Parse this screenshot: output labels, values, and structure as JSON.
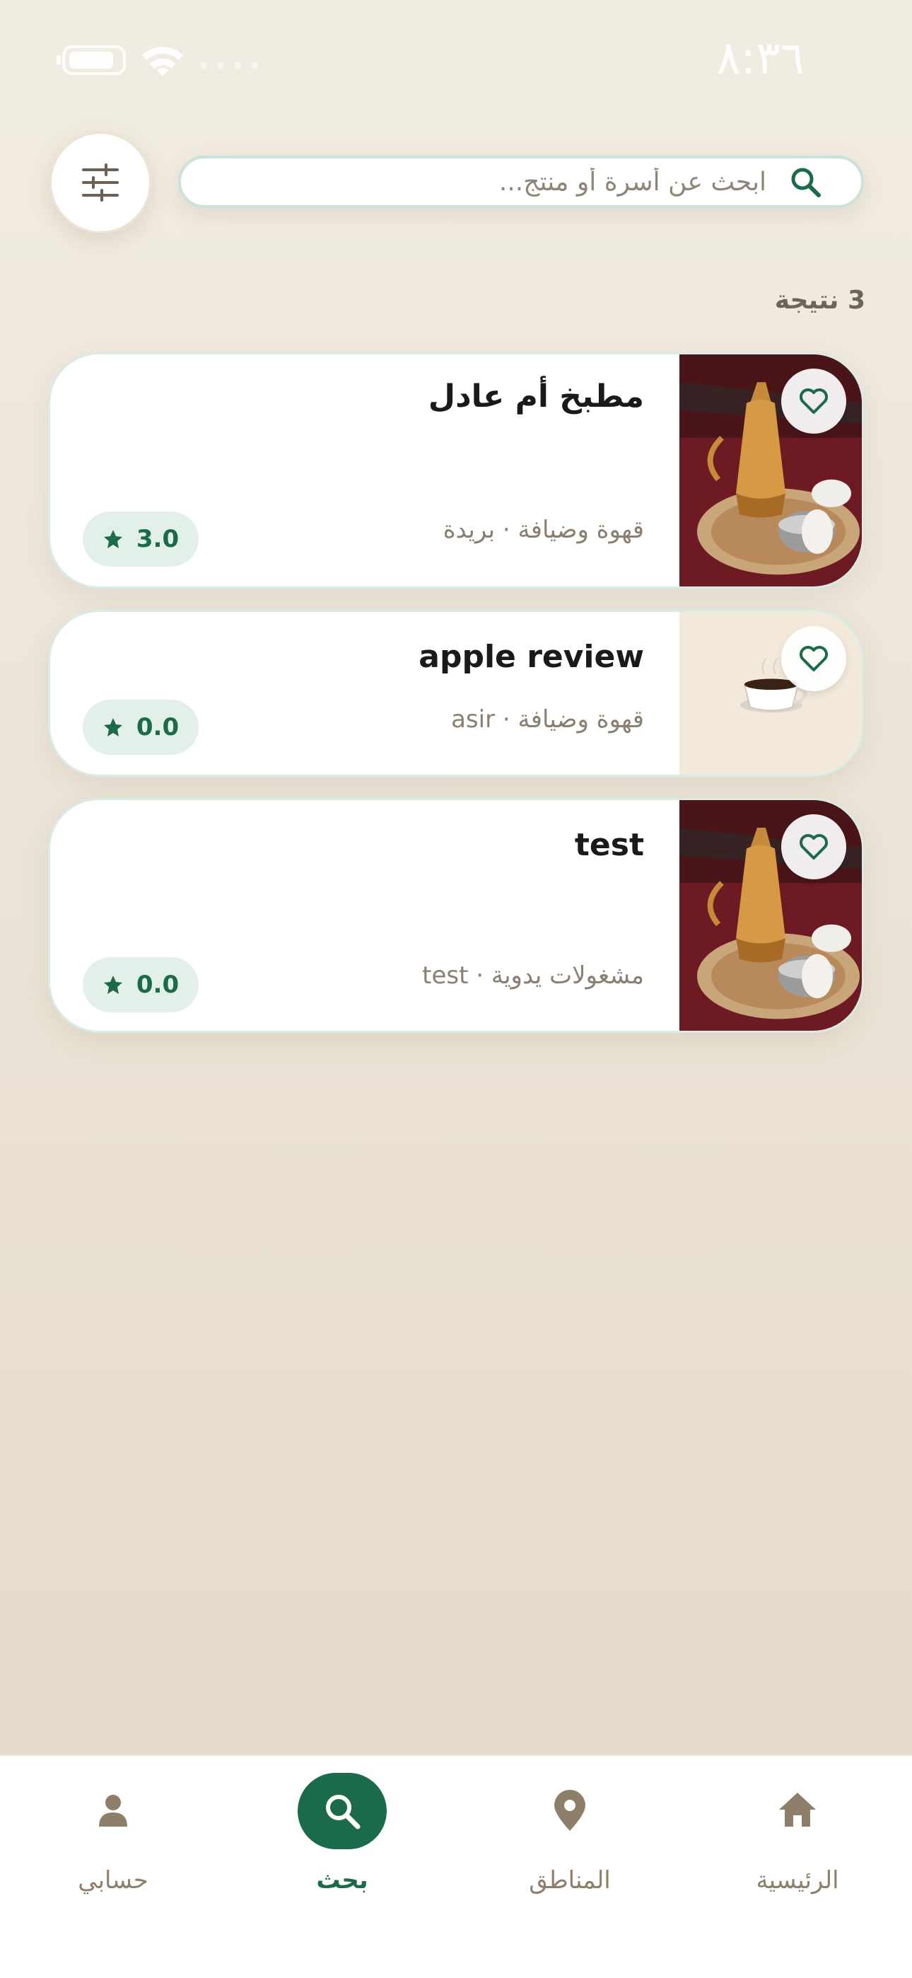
{
  "status_bar": {
    "time": "٨:٣٦"
  },
  "search": {
    "placeholder": "ابحث عن أسرة أو منتج..."
  },
  "results": {
    "count_label": "3 نتيجة"
  },
  "cards": [
    {
      "name": "مطبخ أم عادل",
      "meta": "قهوة وضيافة · بريدة",
      "rating": "3.0",
      "image": "arabic-coffee-dallah-image"
    },
    {
      "name": "apple review",
      "meta": "قهوة وضيافة · asir",
      "rating": "0.0",
      "image": "coffee-cup-image"
    },
    {
      "name": "test",
      "meta": "مشغولات يدوية · test",
      "rating": "0.0",
      "image": "arabic-coffee-dallah-image"
    }
  ],
  "nav": {
    "items": [
      {
        "label": "حسابي",
        "icon": "user-icon"
      },
      {
        "label": "بحث",
        "icon": "search-icon",
        "active": true
      },
      {
        "label": "المناطق",
        "icon": "location-pin-icon"
      },
      {
        "label": "الرئيسية",
        "icon": "home-icon"
      }
    ]
  },
  "colors": {
    "accent": "#1b6b4b",
    "muted": "#8e7f6a",
    "background": "#ebe3d6"
  }
}
